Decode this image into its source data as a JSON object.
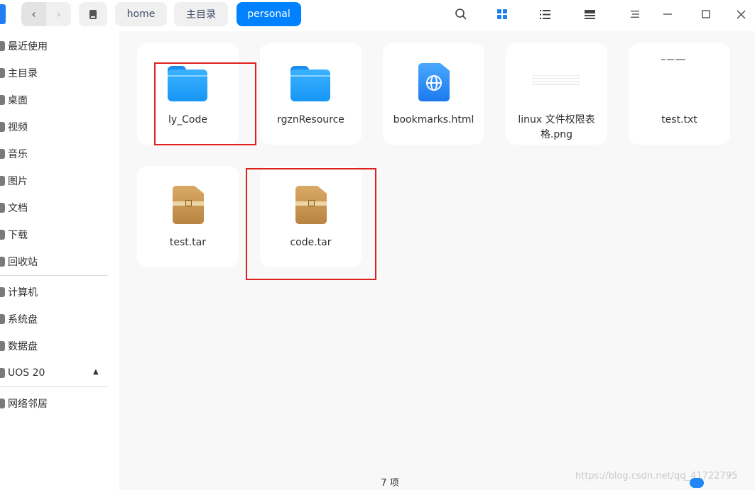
{
  "titlebar": {
    "breadcrumbs": [
      "home",
      "主目录",
      "personal"
    ],
    "accent": "#0081ff",
    "icons": [
      "search-icon",
      "icon-view-icon",
      "list-view-icon",
      "detail-view-icon",
      "menu-icon",
      "minimize-icon",
      "maximize-icon",
      "close-icon"
    ]
  },
  "sidebar": {
    "items": [
      "最近使用",
      "主目录",
      "桌面",
      "视频",
      "音乐",
      "图片",
      "文档",
      "下载",
      "回收站"
    ],
    "devices": [
      "计算机",
      "系统盘",
      "数据盘",
      "UOS 20"
    ],
    "network": [
      "网络邻居"
    ]
  },
  "files": [
    {
      "name": "ly_Code",
      "type": "folder",
      "highlighted": true
    },
    {
      "name": "rgznResource",
      "type": "folder",
      "highlighted": false
    },
    {
      "name": "bookmarks.html",
      "type": "html",
      "highlighted": false
    },
    {
      "name": "linux 文件权限表格.png",
      "type": "image",
      "highlighted": false
    },
    {
      "name": "test.txt",
      "type": "text",
      "highlighted": false
    },
    {
      "name": "test.tar",
      "type": "archive",
      "highlighted": false
    },
    {
      "name": "code.tar",
      "type": "archive",
      "highlighted": true
    }
  ],
  "status": {
    "count": "7 项"
  },
  "watermark": "https://blog.csdn.net/qq_41722795",
  "highlight_color": "#e0201f"
}
